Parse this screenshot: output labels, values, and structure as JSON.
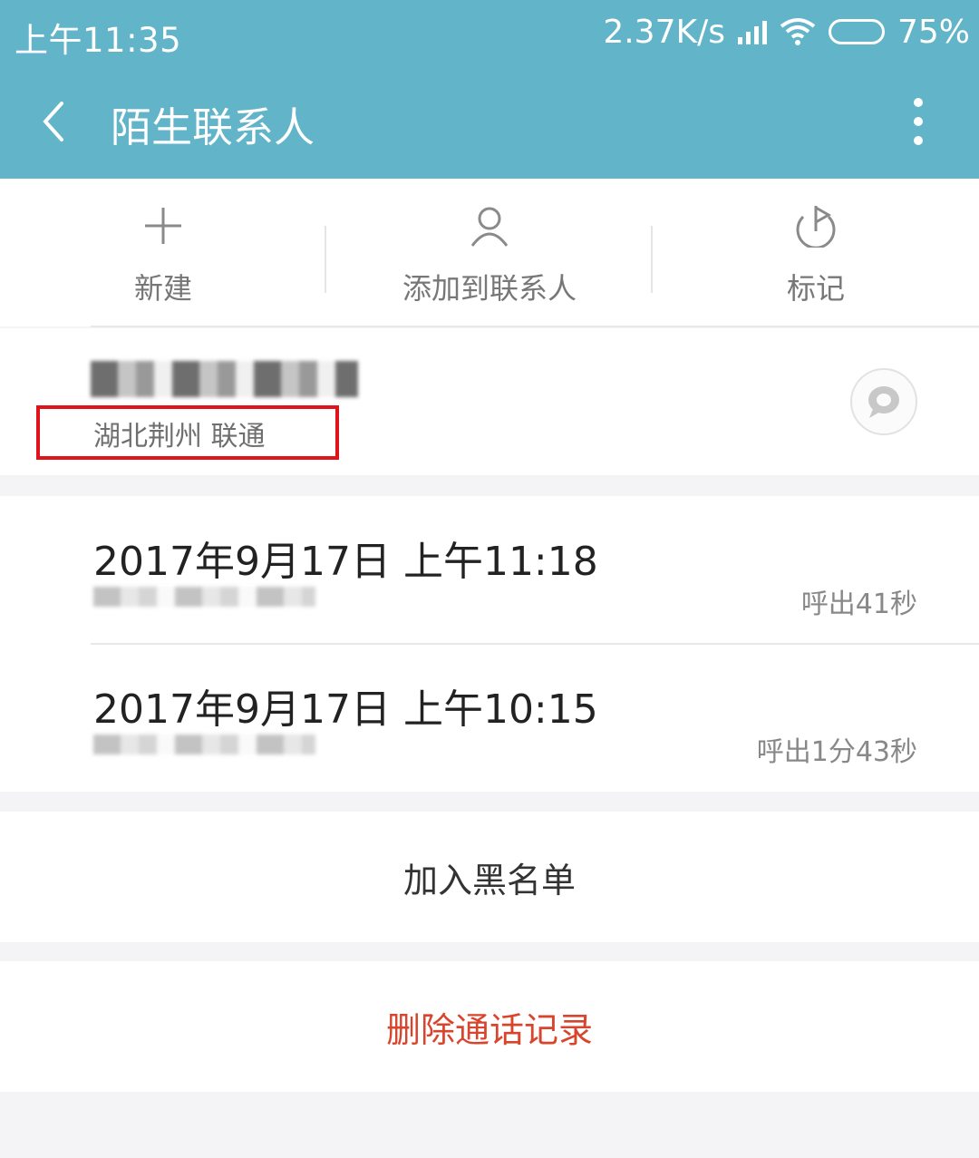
{
  "status_bar": {
    "time": "上午11:35",
    "speed": "2.37K/s",
    "battery": "75%",
    "battery_level": 0.75
  },
  "header": {
    "title": "陌生联系人",
    "bg_color": "#62b4c9"
  },
  "actions": [
    {
      "label": "新建",
      "icon": "plus-icon"
    },
    {
      "label": "添加到联系人",
      "icon": "person-icon"
    },
    {
      "label": "标记",
      "icon": "flag-icon"
    }
  ],
  "contact": {
    "location": "湖北荆州 联通"
  },
  "calls": [
    {
      "datetime": "2017年9月17日 上午11:18",
      "duration": "呼出41秒"
    },
    {
      "datetime": "2017年9月17日 上午10:15",
      "duration": "呼出1分43秒"
    }
  ],
  "buttons": {
    "blacklist": "加入黑名单",
    "delete": "删除通话记录"
  },
  "colors": {
    "delete": "#d9452c",
    "highlight_box": "#e0131b"
  }
}
